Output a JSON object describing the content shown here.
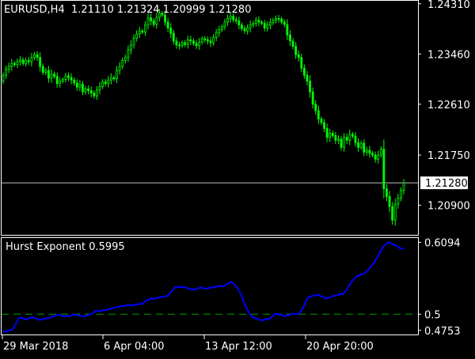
{
  "main": {
    "symbol": "EURUSD,H4",
    "open": "1.21110",
    "high": "1.21324",
    "low": "1.20999",
    "close": "1.21280"
  },
  "indicator": {
    "name": "Hurst Exponent",
    "value": "0.5995"
  },
  "colors": {
    "background": "#000000",
    "frame": "#ffffff",
    "candle": "#00ff00",
    "hurst_line": "#0000ff",
    "level_line": "#00a000",
    "price_line": "#c0c0c0"
  },
  "chart_data": [
    {
      "type": "candlestick",
      "title": "EURUSD,H4  1.21110 1.21324 1.20999 1.21280",
      "y_ticks": [
        "1.24310",
        "1.23460",
        "1.22610",
        "1.21750",
        "1.20900"
      ],
      "current_price": "1.21280",
      "ylim": [
        1.204,
        1.2436
      ],
      "x_ticks": [
        "29 Mar 2018",
        "6 Apr 04:00",
        "13 Apr 12:00",
        "20 Apr 20:00"
      ],
      "close": [
        1.231,
        1.232,
        1.2325,
        1.233,
        1.2328,
        1.2333,
        1.2336,
        1.233,
        1.2335,
        1.2333,
        1.234,
        1.2345,
        1.234,
        1.2325,
        1.2315,
        1.2318,
        1.2305,
        1.2312,
        1.2308,
        1.2296,
        1.23,
        1.2303,
        1.2309,
        1.2306,
        1.2302,
        1.2297,
        1.229,
        1.2295,
        1.2282,
        1.2287,
        1.2284,
        1.228,
        1.2275,
        1.2285,
        1.2291,
        1.2299,
        1.2296,
        1.2302,
        1.2306,
        1.2304,
        1.2318,
        1.2325,
        1.2335,
        1.234,
        1.2353,
        1.2361,
        1.2373,
        1.238,
        1.2385,
        1.2383,
        1.2395,
        1.2407,
        1.2402,
        1.2396,
        1.2408,
        1.2415,
        1.2412,
        1.24,
        1.239,
        1.2381,
        1.2368,
        1.2361,
        1.236,
        1.2365,
        1.2362,
        1.237,
        1.2368,
        1.2364,
        1.236,
        1.2366,
        1.2372,
        1.237,
        1.2368,
        1.2365,
        1.2374,
        1.2382,
        1.2387,
        1.2392,
        1.24,
        1.2406,
        1.241,
        1.2404,
        1.2402,
        1.2395,
        1.2389,
        1.2385,
        1.239,
        1.2395,
        1.2398,
        1.2403,
        1.24,
        1.2398,
        1.239,
        1.2395,
        1.2399,
        1.2403,
        1.2406,
        1.2405,
        1.24,
        1.2396,
        1.2378,
        1.2368,
        1.2359,
        1.2345,
        1.234,
        1.2322,
        1.231,
        1.23,
        1.2282,
        1.2261,
        1.225,
        1.2236,
        1.223,
        1.222,
        1.2205,
        1.2212,
        1.2208,
        1.22,
        1.2202,
        1.2188,
        1.2205,
        1.22,
        1.221,
        1.2207,
        1.2196,
        1.2188,
        1.2195,
        1.218,
        1.2183,
        1.2178,
        1.2175,
        1.2168,
        1.2175,
        1.2185,
        1.2118,
        1.2105,
        1.2088,
        1.2065,
        1.2092,
        1.2102,
        1.2115,
        1.2128
      ]
    },
    {
      "type": "line",
      "title": "Hurst Exponent 0.5995",
      "y_ticks": [
        "0.6094",
        "0.5",
        "0.4753"
      ],
      "level": 0.5,
      "ylim": [
        0.469,
        0.616
      ],
      "values": [
        0.474,
        0.474,
        0.474,
        0.475,
        0.475,
        0.476,
        0.479,
        0.484,
        0.489,
        0.494,
        0.495,
        0.494,
        0.493,
        0.492,
        0.493,
        0.494,
        0.495,
        0.495,
        0.494,
        0.493,
        0.492,
        0.491,
        0.492,
        0.493,
        0.493,
        0.494,
        0.494,
        0.495,
        0.496,
        0.497,
        0.498,
        0.499,
        0.499,
        0.498,
        0.497,
        0.497,
        0.497,
        0.497,
        0.497,
        0.498,
        0.499,
        0.499,
        0.499,
        0.498,
        0.497,
        0.497,
        0.497,
        0.497,
        0.498,
        0.499,
        0.5,
        0.501,
        0.503,
        0.505,
        0.505,
        0.504,
        0.505,
        0.506,
        0.506,
        0.507,
        0.507,
        0.508,
        0.509,
        0.509,
        0.51,
        0.511,
        0.511,
        0.512,
        0.512,
        0.512,
        0.513,
        0.514,
        0.514,
        0.514,
        0.513,
        0.514,
        0.515,
        0.515,
        0.515,
        0.516,
        0.517,
        0.519,
        0.521,
        0.522,
        0.523,
        0.524,
        0.523,
        0.524,
        0.525,
        0.525,
        0.526,
        0.526,
        0.527,
        0.527,
        0.528,
        0.531,
        0.534,
        0.537,
        0.54,
        0.542,
        0.541,
        0.541,
        0.541,
        0.541,
        0.541,
        0.54,
        0.539,
        0.538,
        0.538,
        0.538,
        0.538,
        0.539,
        0.54,
        0.541,
        0.54,
        0.539,
        0.539,
        0.539,
        0.54,
        0.541,
        0.541,
        0.541,
        0.542,
        0.543,
        0.543,
        0.543,
        0.542,
        0.544,
        0.546,
        0.547,
        0.549,
        0.548,
        0.546,
        0.543,
        0.54,
        0.535,
        0.53,
        0.523,
        0.516,
        0.51,
        0.505,
        0.5,
        0.497,
        0.495,
        0.494,
        0.493,
        0.492,
        0.491,
        0.491,
        0.491,
        0.492,
        0.493,
        0.492,
        0.494,
        0.497,
        0.5,
        0.5,
        0.5,
        0.499,
        0.499,
        0.498,
        0.497,
        0.498,
        0.498,
        0.499,
        0.5,
        0.501,
        0.5,
        0.5,
        0.501,
        0.503,
        0.508,
        0.513,
        0.519,
        0.525,
        0.526,
        0.527,
        0.528,
        0.528,
        0.529,
        0.53,
        0.528,
        0.527,
        0.526,
        0.525,
        0.524,
        0.525,
        0.526,
        0.527,
        0.528,
        0.528,
        0.529,
        0.53,
        0.531,
        0.53,
        0.533,
        0.536,
        0.54,
        0.545,
        0.549,
        0.552,
        0.555,
        0.557,
        0.559,
        0.559,
        0.561,
        0.561,
        0.563,
        0.566,
        0.568,
        0.572,
        0.575,
        0.578,
        0.583,
        0.587,
        0.592,
        0.597,
        0.601,
        0.605,
        0.607,
        0.609,
        0.609,
        0.607,
        0.606,
        0.605,
        0.604,
        0.602,
        0.6,
        0.6,
        0.5995
      ]
    }
  ]
}
